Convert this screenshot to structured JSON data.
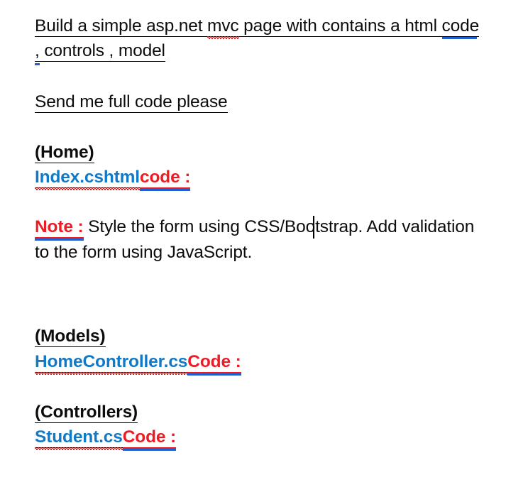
{
  "document": {
    "kind": "word-processor-document",
    "background_color": "#FFFFFF",
    "colors": {
      "text": "#0C0C0C",
      "filename_blue": "#1279C6",
      "label_red": "#ED1C24",
      "spellcheck_red": "#E02020",
      "grammar_blue": "#1F5FD0"
    },
    "caret_visible": true,
    "paragraphs": {
      "request_line1": "Build a simple asp.net mvc page with contains a html code",
      "request_line1_a": "Build a simple asp.net ",
      "request_line1_mvc": "mvc",
      "request_line1_b": " page with contains a html ",
      "request_line1_code": "code",
      "request_line2": ", controls , model",
      "send_request": "Send me full code please",
      "section_home": "(Home)",
      "file_index": "Index.cshtml",
      "label_code_lower": " code :",
      "label_note": "Note :",
      "note_body_line1_a": " Style the form using CSS/Boo",
      "note_body_line1_b": "tstrap. Add validation",
      "note_body_line2": "to the form using JavaScript.",
      "section_models": "(Models)",
      "file_homecontroller": "HomeController.cs",
      "label_code_upper": " Code :",
      "section_controllers": "(Controllers)",
      "file_student": "Student.cs"
    }
  }
}
